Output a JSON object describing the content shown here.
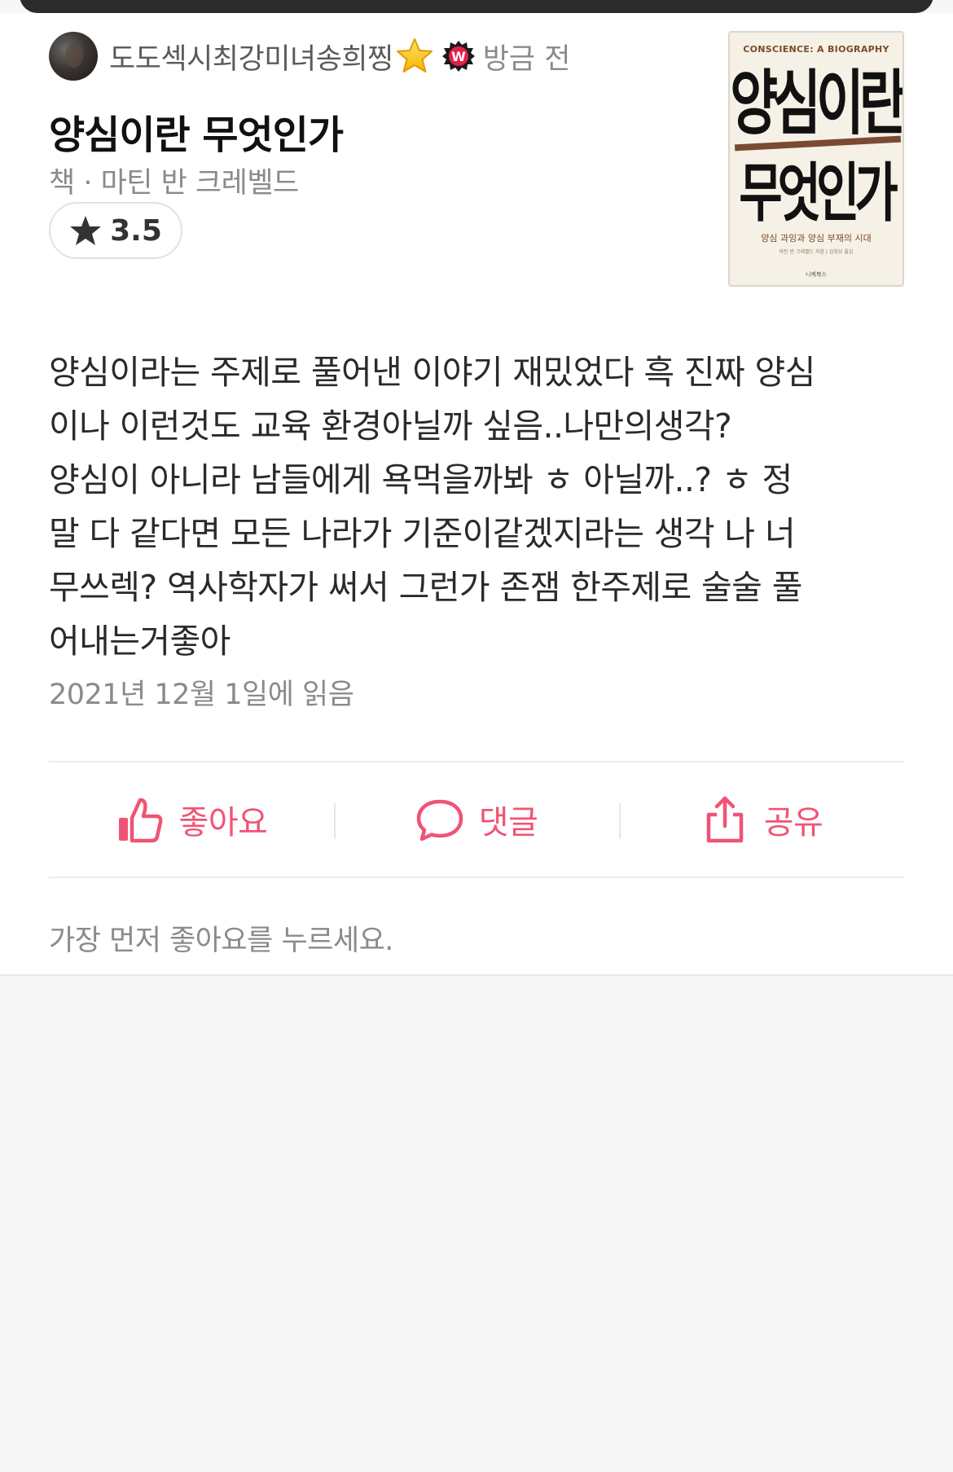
{
  "post": {
    "author_name": "도도섹시최강미녀송희찡",
    "time": "방금 전",
    "book_title": "양심이란 무엇인가",
    "meta": "책 · 마틴 반 크레벨드",
    "rating": "3.5",
    "review": "양심이라는 주제로 풀어낸 이야기 재밌었다 흑 진짜 양심\n이나 이런것도 교육 환경아닐까 싶음..나만의생각?\n양심이 아니라 남들에게 욕먹을까봐 ㅎ 아닐까..? ㅎ 정\n말 다 같다면 모든 나라가 기준이같겠지라는 생각 나 너\n무쓰렉? 역사학자가 써서 그런가 존잼 한주제로 술술 풀\n어내는거좋아",
    "read_date": "2021년 12월 1일에 읽음"
  },
  "cover": {
    "subtitle_en": "CONSCIENCE: A BIOGRAPHY",
    "title_line1": "양심이란",
    "title_line2": "무엇인가",
    "tagline": "양심 과잉과 양심 부재의 시대",
    "credits": "마틴 반 크레벨드 지음 | 김희상 옮김",
    "publisher": "니케북스"
  },
  "actions": {
    "like": "좋아요",
    "comment": "댓글",
    "share": "공유"
  },
  "footer": {
    "first_like_prompt": "가장 먼저 좋아요를 누르세요."
  },
  "colors": {
    "accent": "#f05474",
    "star": "#333333",
    "badge_red": "#e4204a"
  },
  "icons": {
    "rating": "star-icon",
    "like": "thumbs-up-icon",
    "comment": "speech-bubble-icon",
    "share": "share-icon"
  }
}
